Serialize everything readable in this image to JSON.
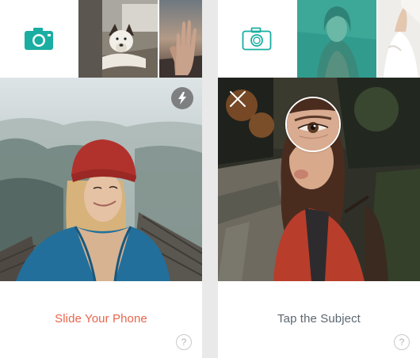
{
  "left_screen": {
    "instruction": "Slide Your Phone",
    "help_label": "?",
    "camera_style": "filled",
    "thumbnails": [
      "dog-in-car-photo",
      "hand-at-sunset-photo"
    ],
    "main_photo": "woman-in-red-beanie-on-misty-bridge",
    "flash_icon": "lightning-bolt"
  },
  "right_screen": {
    "instruction": "Tap the Subject",
    "help_label": "?",
    "camera_style": "outline",
    "thumbnails": [
      "woman-portrait-teal-overlay-photo",
      "woman-in-white-photo"
    ],
    "main_photo": "woman-in-red-jacket-autumn-street",
    "close_icon": "x-mark",
    "magnifier": "eye-closeup"
  },
  "colors": {
    "accent_teal": "#1aaea2",
    "instruction_orange": "#e8654b",
    "instruction_gray": "#5c6770"
  }
}
